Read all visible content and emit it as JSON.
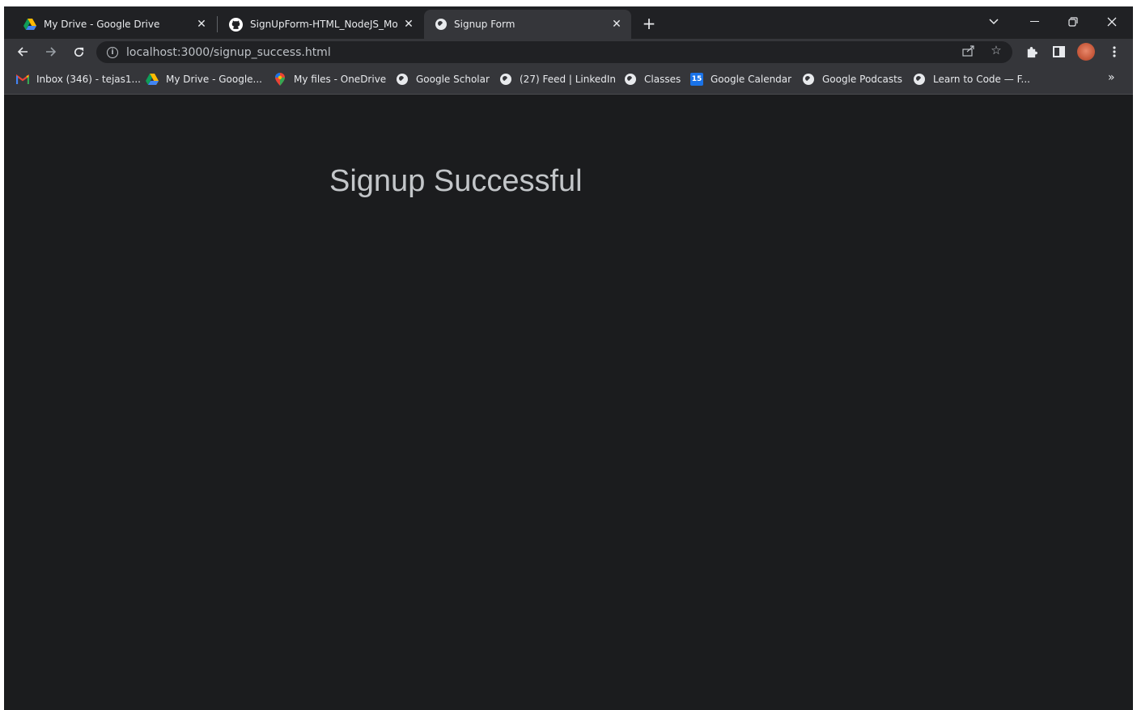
{
  "tabs": [
    {
      "title": "My Drive - Google Drive",
      "icon": "google-drive-icon",
      "active": false
    },
    {
      "title": "SignUpForm-HTML_NodeJS_Mo",
      "icon": "github-icon",
      "active": false
    },
    {
      "title": "Signup Form",
      "icon": "globe-icon",
      "active": true
    }
  ],
  "toolbar": {
    "url": "localhost:3000/signup_success.html"
  },
  "bookmarks": [
    {
      "label": "Inbox (346) - tejas1...",
      "icon": "gmail-icon"
    },
    {
      "label": "My Drive - Google...",
      "icon": "google-drive-icon"
    },
    {
      "label": "My files - OneDrive",
      "icon": "maps-pin-icon"
    },
    {
      "label": "Google Scholar",
      "icon": "globe-icon"
    },
    {
      "label": "(27) Feed | LinkedIn",
      "icon": "globe-icon"
    },
    {
      "label": "Classes",
      "icon": "globe-icon"
    },
    {
      "label": "Google Calendar",
      "icon": "google-calendar-icon",
      "icon_text": "15"
    },
    {
      "label": "Google Podcasts",
      "icon": "globe-icon"
    },
    {
      "label": "Learn to Code — F...",
      "icon": "globe-icon"
    }
  ],
  "page": {
    "heading": "Signup Successful"
  },
  "colors": {
    "tab_strip": "#202124",
    "toolbar": "#35363a",
    "page_bg": "#1b1c1e",
    "heading_text": "#c3c6c9"
  }
}
